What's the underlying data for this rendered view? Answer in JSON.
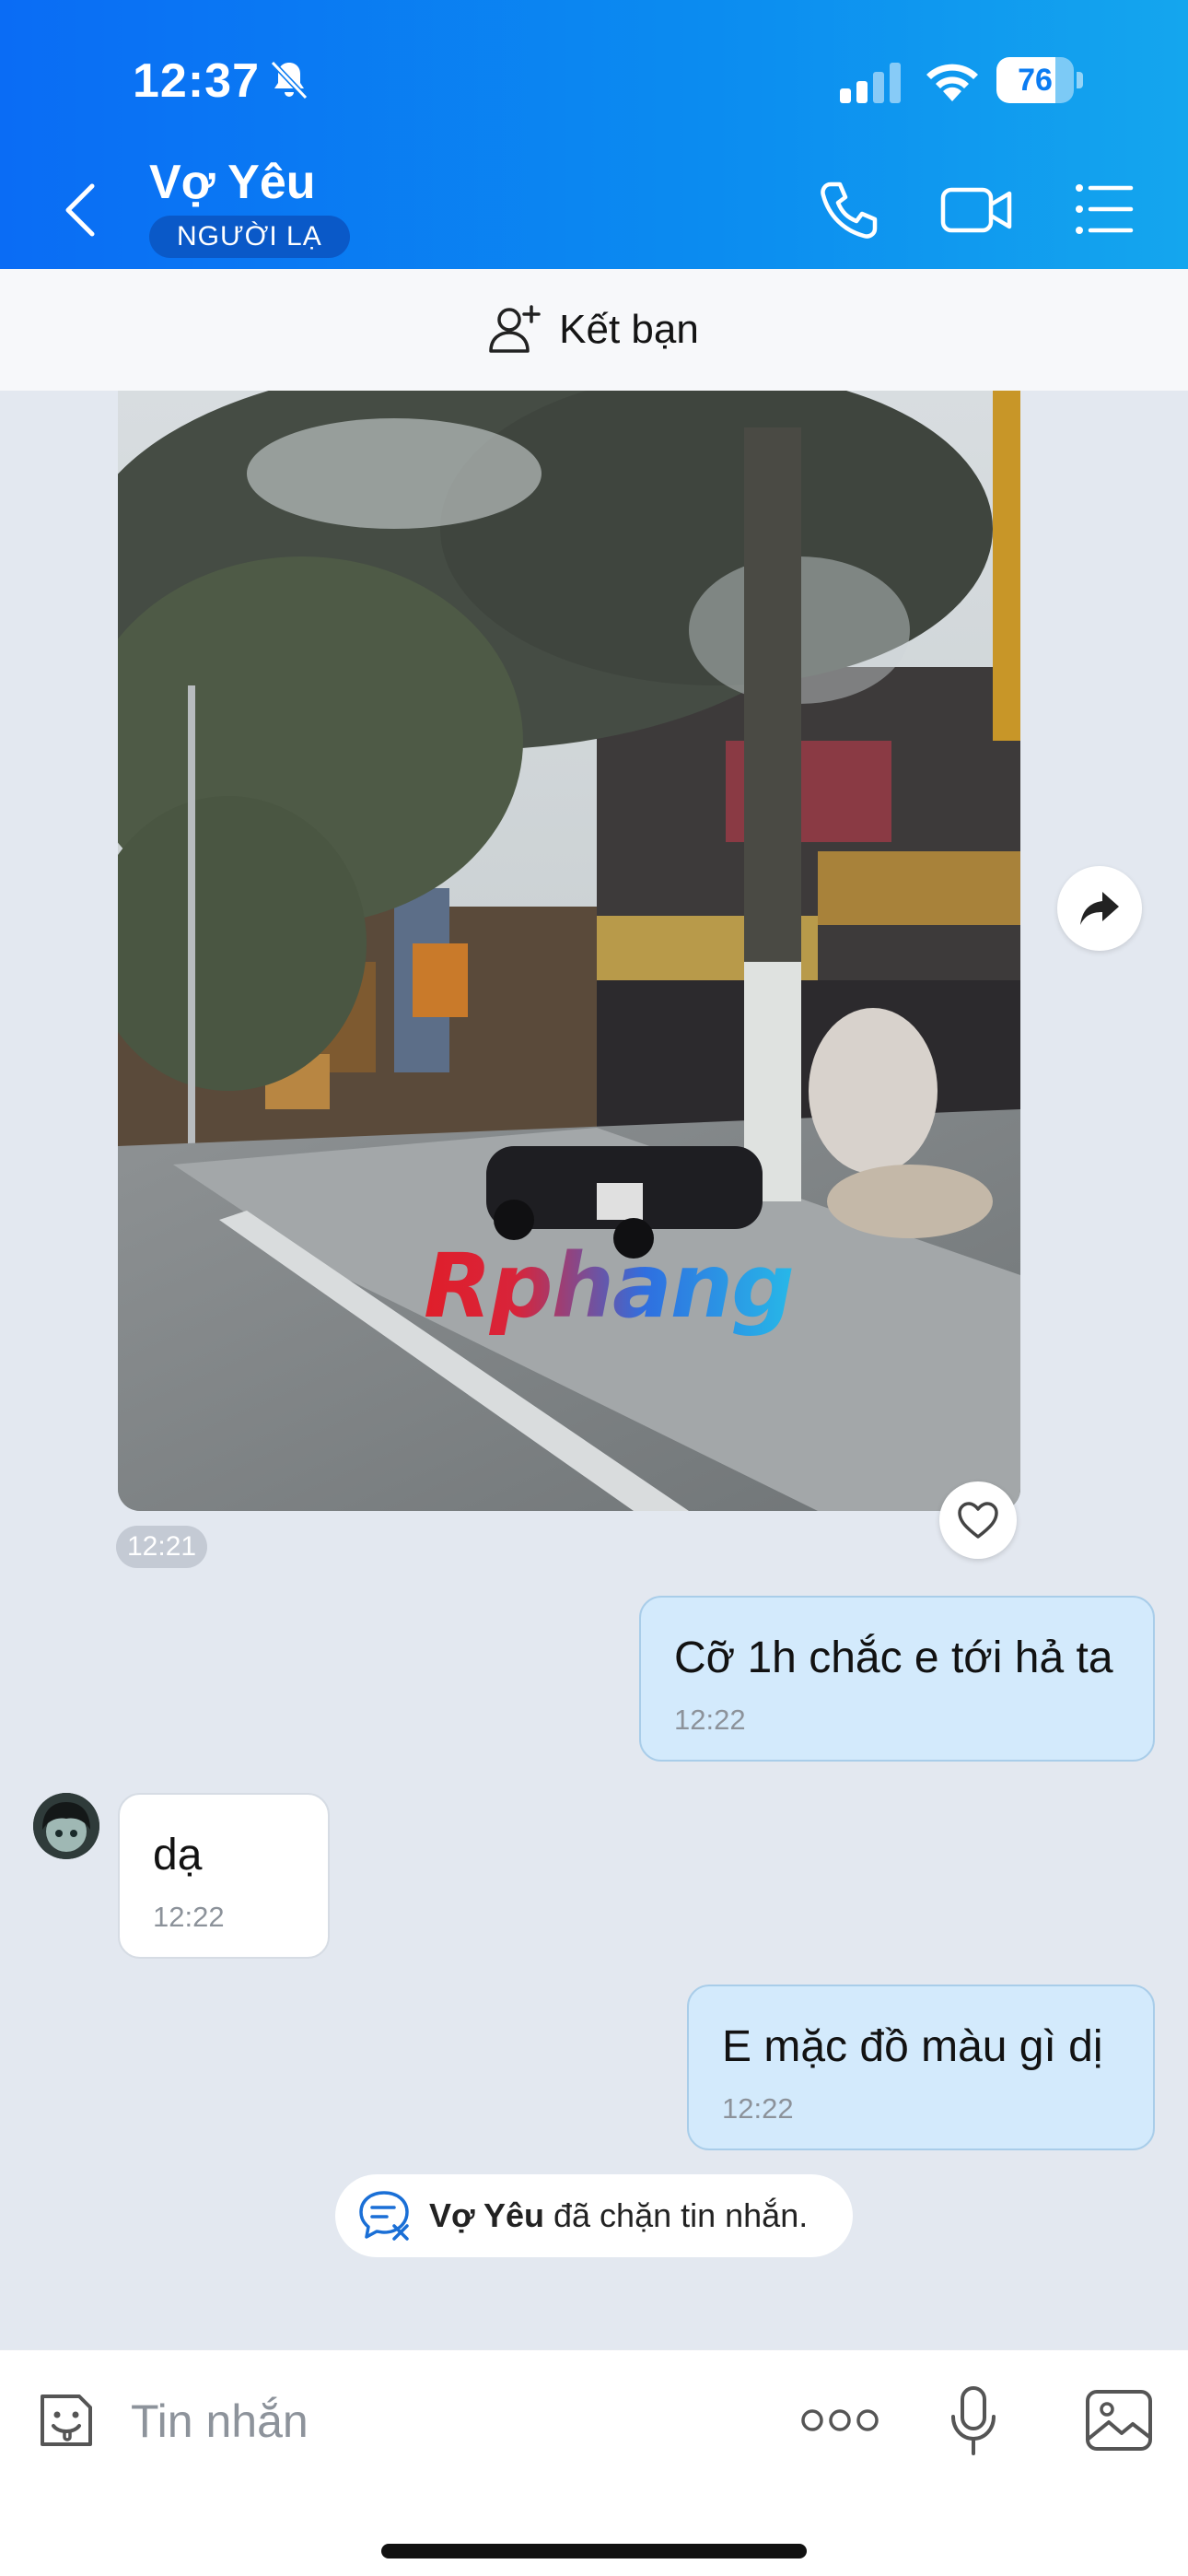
{
  "status_bar": {
    "time": "12:37",
    "battery_percent": "76",
    "battery_level": 0.76
  },
  "header": {
    "contact_name": "Vợ Yêu",
    "badge": "NGƯỜI LẠ",
    "icons": [
      "back-icon",
      "phone-icon",
      "video-camera-icon",
      "list-menu-icon"
    ]
  },
  "friend_bar": {
    "label": "Kết bạn",
    "icon": "add-friend-icon"
  },
  "messages": [
    {
      "type": "video",
      "direction": "in",
      "time": "12:21",
      "watermark": "Rphang"
    },
    {
      "type": "text",
      "direction": "out",
      "text": "Cỡ 1h chắc e tới hả ta",
      "time": "12:22"
    },
    {
      "type": "text",
      "direction": "in",
      "text": "dạ",
      "time": "12:22"
    },
    {
      "type": "text",
      "direction": "out",
      "text": "E mặc đồ màu gì dị",
      "time": "12:22"
    }
  ],
  "blocked_notice": {
    "name": "Vợ Yêu",
    "text": "đã chặn tin nhắn."
  },
  "input_bar": {
    "placeholder": "Tin nhắn",
    "icons": [
      "sticker-icon",
      "more-icon",
      "microphone-icon",
      "image-icon"
    ]
  },
  "colors": {
    "header_start": "#0a6cf5",
    "header_end": "#14a6ee",
    "outgoing_bubble": "#d3eafc",
    "incoming_bubble": "#ffffff",
    "chat_background": "#e3e8f0"
  }
}
